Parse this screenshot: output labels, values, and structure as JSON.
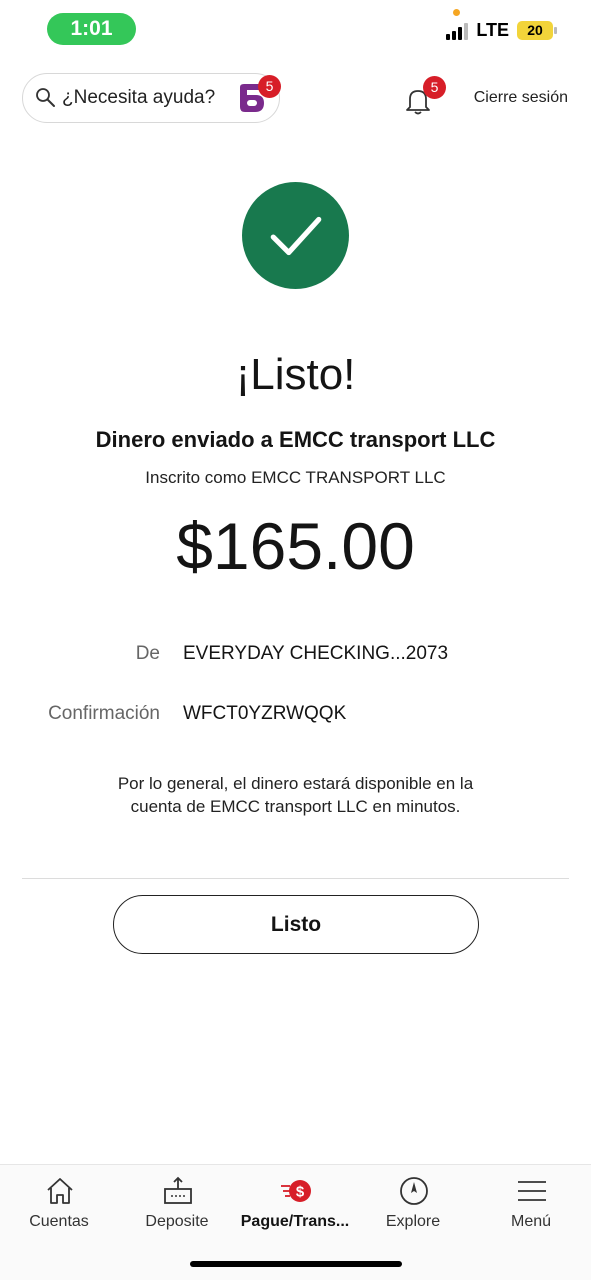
{
  "status_bar": {
    "time": "1:01",
    "network": "LTE",
    "battery": "20",
    "accent": "#34c759"
  },
  "header": {
    "search_placeholder": "¿Necesita ayuda?",
    "assistant_badge_count": "5",
    "notifications_count": "5",
    "logout_label": "Cierre sesión"
  },
  "confirmation": {
    "title": "¡Listo!",
    "sent_to": "Dinero enviado a EMCC transport LLC",
    "enrolled_as": "Inscrito como EMCC TRANSPORT LLC",
    "amount": "$165.00",
    "details": [
      {
        "label": "De",
        "value": "EVERYDAY CHECKING...2073"
      },
      {
        "label": "Confirmación",
        "value": "WFCT0YZRWQQK"
      }
    ],
    "note": "Por lo general, el dinero estará disponible en la cuenta de EMCC transport LLC en minutos.",
    "done_button": "Listo",
    "success_color": "#18794e"
  },
  "bottom_nav": {
    "items": [
      {
        "label": "Cuentas",
        "icon": "home-icon"
      },
      {
        "label": "Deposite",
        "icon": "deposit-icon"
      },
      {
        "label": "Pague/Trans...",
        "icon": "pay-transfer-icon",
        "active": true
      },
      {
        "label": "Explore",
        "icon": "compass-icon"
      },
      {
        "label": "Menú",
        "icon": "hamburger-menu-icon"
      }
    ]
  },
  "brand_colors": {
    "red": "#d71e28",
    "purple": "#7a2a8c"
  }
}
